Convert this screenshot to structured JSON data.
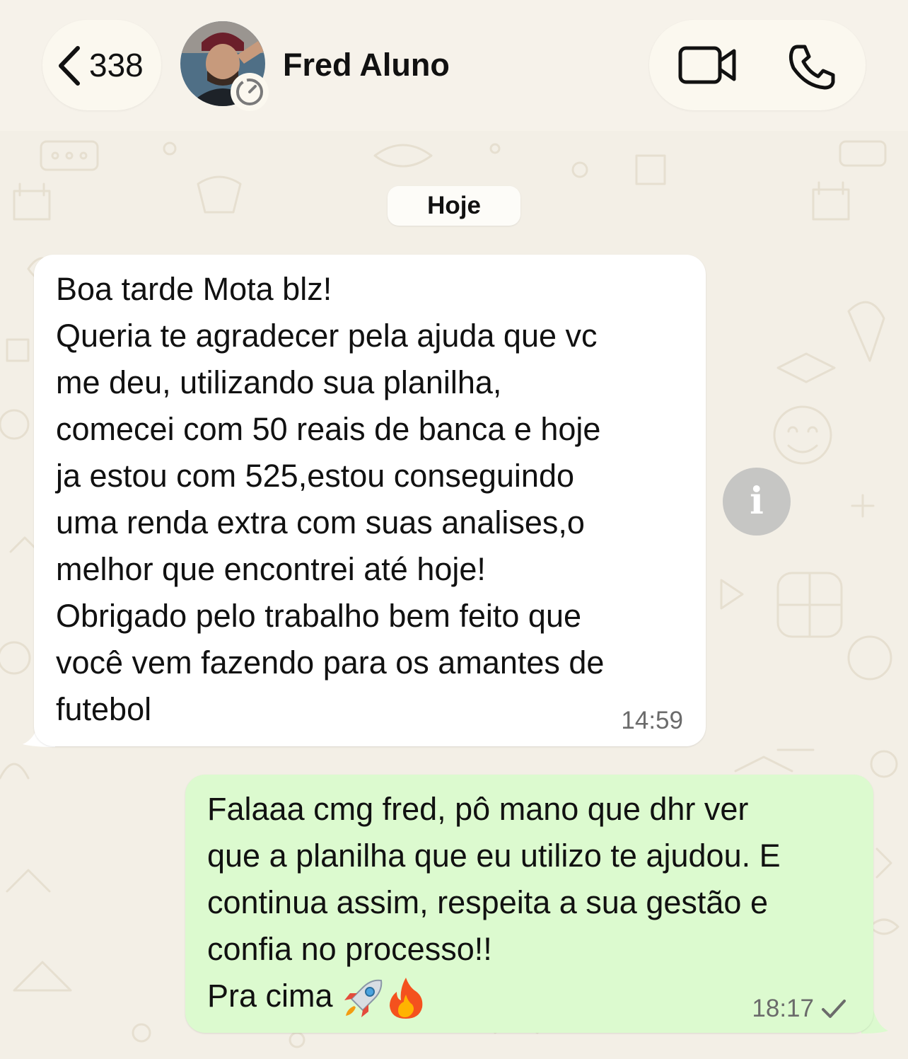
{
  "header": {
    "back_count": "338",
    "contact_name": "Fred Aluno",
    "icons": [
      "chevron-left-icon",
      "video-call-icon",
      "phone-call-icon",
      "disappearing-timer-icon"
    ]
  },
  "chat": {
    "date_label": "Hoje",
    "messages": [
      {
        "direction": "incoming",
        "text": "Boa tarde Mota blz!\nQueria te agradecer pela ajuda que vc\nme deu, utilizando sua planilha,\ncomecei com 50 reais de banca e hoje\nja estou com 525,estou conseguindo\numa renda extra com suas analises,o\nmelhor que encontrei até hoje!\nObrigado pelo trabalho bem feito que\nvocê vem fazendo para os amantes de\nfutebol",
        "time": "14:59"
      },
      {
        "direction": "outgoing",
        "text": "Falaaa cmg fred, pô mano que dhr ver\nque a planilha que eu utilizo te ajudou. E\ncontinua assim, respeita a sua gestão e\nconfia no processo!!\nPra cima",
        "emojis": [
          "rocket-icon",
          "fire-icon"
        ],
        "time": "18:17",
        "status": "sent-check-icon"
      }
    ]
  },
  "colors": {
    "background": "#f3efe6",
    "incoming_bubble": "#ffffff",
    "outgoing_bubble": "#dcfacf",
    "info_button": "#c6c6c4"
  }
}
